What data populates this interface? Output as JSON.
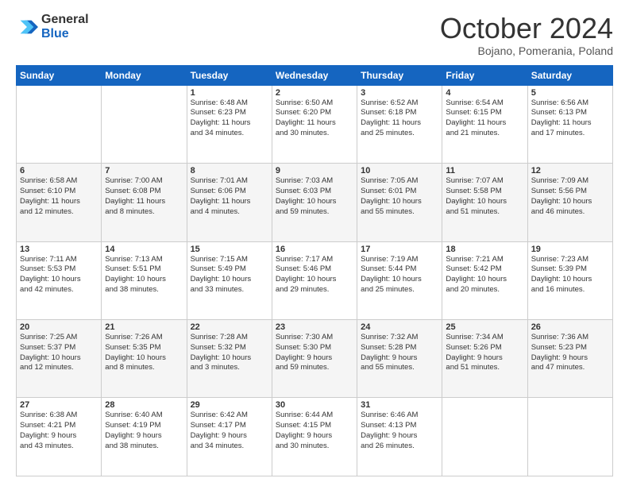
{
  "logo": {
    "general": "General",
    "blue": "Blue"
  },
  "header": {
    "title": "October 2024",
    "subtitle": "Bojano, Pomerania, Poland"
  },
  "days_of_week": [
    "Sunday",
    "Monday",
    "Tuesday",
    "Wednesday",
    "Thursday",
    "Friday",
    "Saturday"
  ],
  "weeks": [
    [
      {
        "day": "",
        "info": ""
      },
      {
        "day": "",
        "info": ""
      },
      {
        "day": "1",
        "info": "Sunrise: 6:48 AM\nSunset: 6:23 PM\nDaylight: 11 hours\nand 34 minutes."
      },
      {
        "day": "2",
        "info": "Sunrise: 6:50 AM\nSunset: 6:20 PM\nDaylight: 11 hours\nand 30 minutes."
      },
      {
        "day": "3",
        "info": "Sunrise: 6:52 AM\nSunset: 6:18 PM\nDaylight: 11 hours\nand 25 minutes."
      },
      {
        "day": "4",
        "info": "Sunrise: 6:54 AM\nSunset: 6:15 PM\nDaylight: 11 hours\nand 21 minutes."
      },
      {
        "day": "5",
        "info": "Sunrise: 6:56 AM\nSunset: 6:13 PM\nDaylight: 11 hours\nand 17 minutes."
      }
    ],
    [
      {
        "day": "6",
        "info": "Sunrise: 6:58 AM\nSunset: 6:10 PM\nDaylight: 11 hours\nand 12 minutes."
      },
      {
        "day": "7",
        "info": "Sunrise: 7:00 AM\nSunset: 6:08 PM\nDaylight: 11 hours\nand 8 minutes."
      },
      {
        "day": "8",
        "info": "Sunrise: 7:01 AM\nSunset: 6:06 PM\nDaylight: 11 hours\nand 4 minutes."
      },
      {
        "day": "9",
        "info": "Sunrise: 7:03 AM\nSunset: 6:03 PM\nDaylight: 10 hours\nand 59 minutes."
      },
      {
        "day": "10",
        "info": "Sunrise: 7:05 AM\nSunset: 6:01 PM\nDaylight: 10 hours\nand 55 minutes."
      },
      {
        "day": "11",
        "info": "Sunrise: 7:07 AM\nSunset: 5:58 PM\nDaylight: 10 hours\nand 51 minutes."
      },
      {
        "day": "12",
        "info": "Sunrise: 7:09 AM\nSunset: 5:56 PM\nDaylight: 10 hours\nand 46 minutes."
      }
    ],
    [
      {
        "day": "13",
        "info": "Sunrise: 7:11 AM\nSunset: 5:53 PM\nDaylight: 10 hours\nand 42 minutes."
      },
      {
        "day": "14",
        "info": "Sunrise: 7:13 AM\nSunset: 5:51 PM\nDaylight: 10 hours\nand 38 minutes."
      },
      {
        "day": "15",
        "info": "Sunrise: 7:15 AM\nSunset: 5:49 PM\nDaylight: 10 hours\nand 33 minutes."
      },
      {
        "day": "16",
        "info": "Sunrise: 7:17 AM\nSunset: 5:46 PM\nDaylight: 10 hours\nand 29 minutes."
      },
      {
        "day": "17",
        "info": "Sunrise: 7:19 AM\nSunset: 5:44 PM\nDaylight: 10 hours\nand 25 minutes."
      },
      {
        "day": "18",
        "info": "Sunrise: 7:21 AM\nSunset: 5:42 PM\nDaylight: 10 hours\nand 20 minutes."
      },
      {
        "day": "19",
        "info": "Sunrise: 7:23 AM\nSunset: 5:39 PM\nDaylight: 10 hours\nand 16 minutes."
      }
    ],
    [
      {
        "day": "20",
        "info": "Sunrise: 7:25 AM\nSunset: 5:37 PM\nDaylight: 10 hours\nand 12 minutes."
      },
      {
        "day": "21",
        "info": "Sunrise: 7:26 AM\nSunset: 5:35 PM\nDaylight: 10 hours\nand 8 minutes."
      },
      {
        "day": "22",
        "info": "Sunrise: 7:28 AM\nSunset: 5:32 PM\nDaylight: 10 hours\nand 3 minutes."
      },
      {
        "day": "23",
        "info": "Sunrise: 7:30 AM\nSunset: 5:30 PM\nDaylight: 9 hours\nand 59 minutes."
      },
      {
        "day": "24",
        "info": "Sunrise: 7:32 AM\nSunset: 5:28 PM\nDaylight: 9 hours\nand 55 minutes."
      },
      {
        "day": "25",
        "info": "Sunrise: 7:34 AM\nSunset: 5:26 PM\nDaylight: 9 hours\nand 51 minutes."
      },
      {
        "day": "26",
        "info": "Sunrise: 7:36 AM\nSunset: 5:23 PM\nDaylight: 9 hours\nand 47 minutes."
      }
    ],
    [
      {
        "day": "27",
        "info": "Sunrise: 6:38 AM\nSunset: 4:21 PM\nDaylight: 9 hours\nand 43 minutes."
      },
      {
        "day": "28",
        "info": "Sunrise: 6:40 AM\nSunset: 4:19 PM\nDaylight: 9 hours\nand 38 minutes."
      },
      {
        "day": "29",
        "info": "Sunrise: 6:42 AM\nSunset: 4:17 PM\nDaylight: 9 hours\nand 34 minutes."
      },
      {
        "day": "30",
        "info": "Sunrise: 6:44 AM\nSunset: 4:15 PM\nDaylight: 9 hours\nand 30 minutes."
      },
      {
        "day": "31",
        "info": "Sunrise: 6:46 AM\nSunset: 4:13 PM\nDaylight: 9 hours\nand 26 minutes."
      },
      {
        "day": "",
        "info": ""
      },
      {
        "day": "",
        "info": ""
      }
    ]
  ]
}
